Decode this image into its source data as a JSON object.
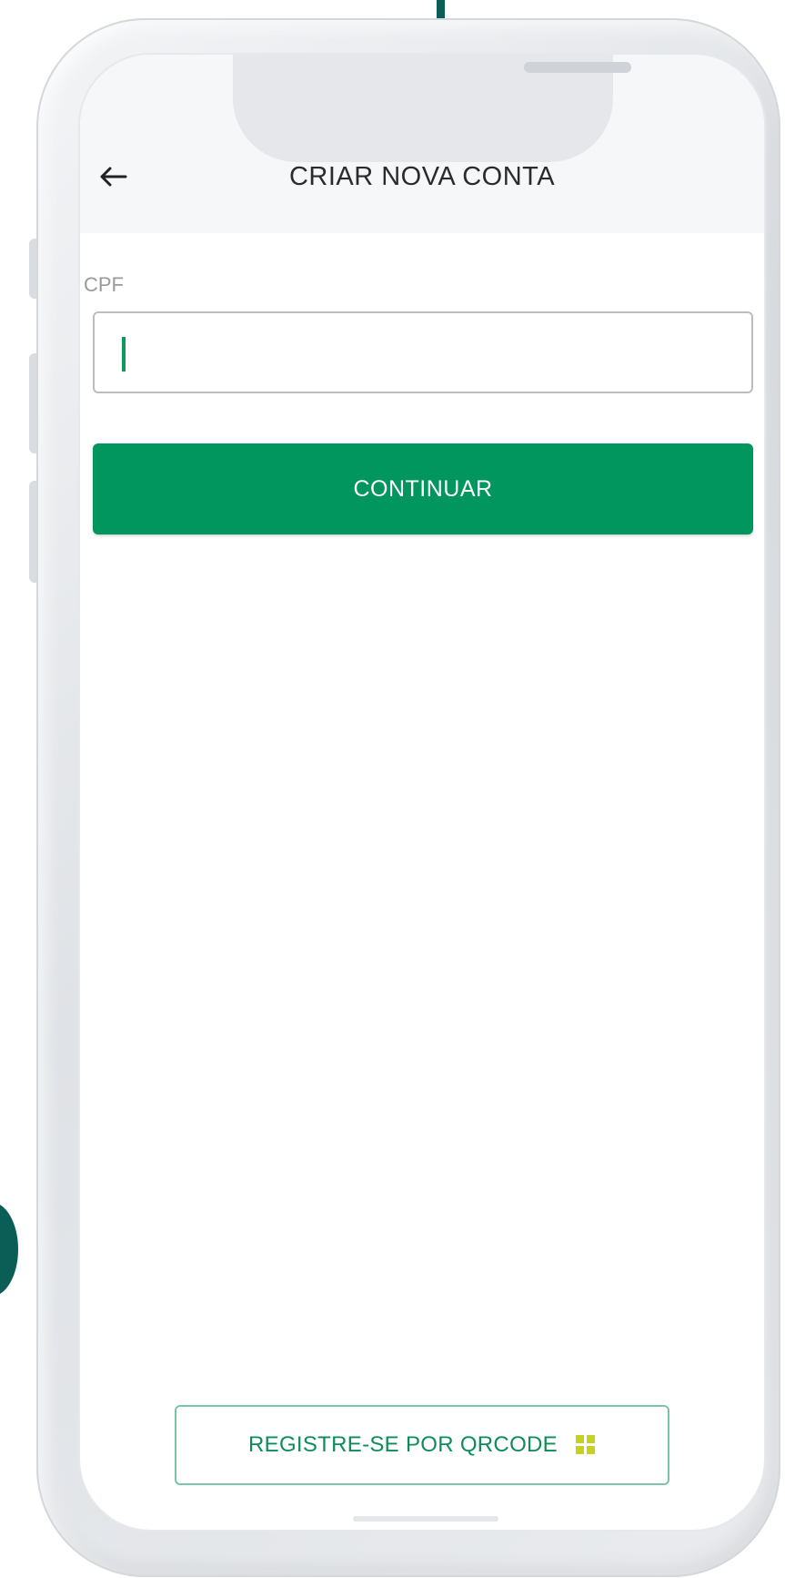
{
  "header": {
    "title": "CRIAR NOVA CONTA",
    "back_icon": "arrow-left-icon"
  },
  "form": {
    "cpf_label": "CPF",
    "cpf_value": "",
    "continue_label": "CONTINUAR"
  },
  "footer": {
    "qr_label": "REGISTRE-SE POR QRCODE",
    "qr_icon": "qrcode-icon"
  },
  "colors": {
    "primary": "#00965e",
    "accent_teal": "#0b5e55",
    "qr_icon": "#c9d11f"
  }
}
